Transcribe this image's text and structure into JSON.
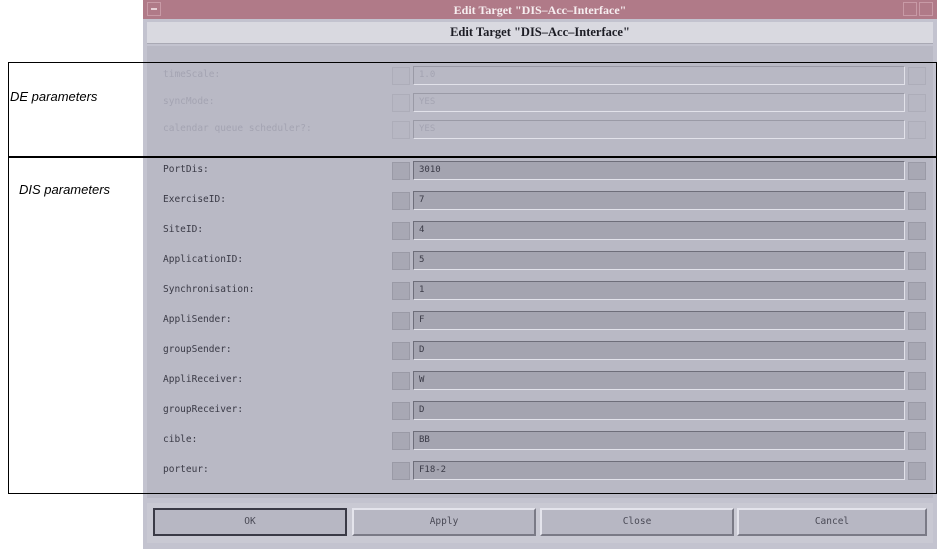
{
  "window": {
    "title": "Edit Target \"DIS–Acc–Interface\""
  },
  "dialog": {
    "heading": "Edit Target \"DIS–Acc–Interface\""
  },
  "annotations": {
    "de_label": "DE parameters",
    "dis_label": "DIS parameters"
  },
  "de_parameters": [
    {
      "label": "timeScale:",
      "value": "1.0"
    },
    {
      "label": "syncMode:",
      "value": "YES"
    },
    {
      "label": "calendar queue scheduler?:",
      "value": "YES"
    }
  ],
  "dis_parameters": [
    {
      "label": "PortDis:",
      "value": "3010"
    },
    {
      "label": "ExerciseID:",
      "value": "7"
    },
    {
      "label": "SiteID:",
      "value": "4"
    },
    {
      "label": "ApplicationID:",
      "value": "5"
    },
    {
      "label": "Synchronisation:",
      "value": "1"
    },
    {
      "label": "AppliSender:",
      "value": "F"
    },
    {
      "label": "groupSender:",
      "value": "D"
    },
    {
      "label": "AppliReceiver:",
      "value": "W"
    },
    {
      "label": "groupReceiver:",
      "value": "D"
    },
    {
      "label": "cible:",
      "value": "BB"
    },
    {
      "label": "porteur:",
      "value": "F18-2"
    }
  ],
  "buttons": {
    "ok": "OK",
    "apply": "Apply",
    "close": "Close",
    "cancel": "Cancel"
  },
  "colors": {
    "titlebar": "#b07a88",
    "panel": "#b9b9c5",
    "field": "#a4a4b0"
  }
}
